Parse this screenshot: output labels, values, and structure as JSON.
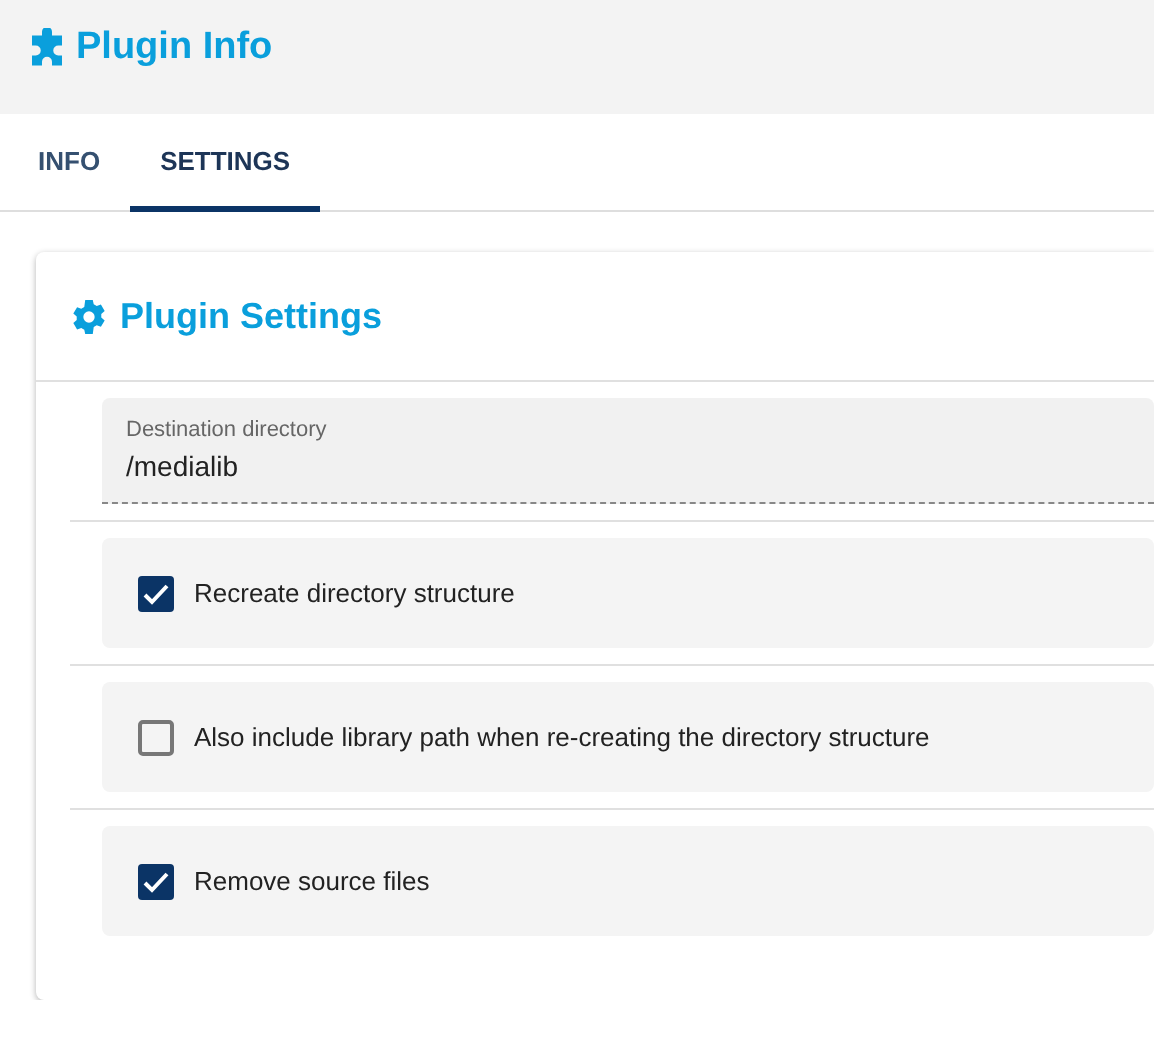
{
  "header": {
    "title": "Plugin Info"
  },
  "tabs": [
    {
      "label": "INFO",
      "selected": false
    },
    {
      "label": "SETTINGS",
      "selected": true
    }
  ],
  "card": {
    "title": "Plugin Settings",
    "settings": [
      {
        "kind": "text",
        "label": "Destination directory",
        "value": "/medialib"
      },
      {
        "kind": "checkbox",
        "label": "Recreate directory structure",
        "checked": true
      },
      {
        "kind": "checkbox",
        "label": "Also include library path when re-creating the directory structure",
        "checked": false
      },
      {
        "kind": "checkbox",
        "label": "Remove source files",
        "checked": true
      }
    ]
  }
}
